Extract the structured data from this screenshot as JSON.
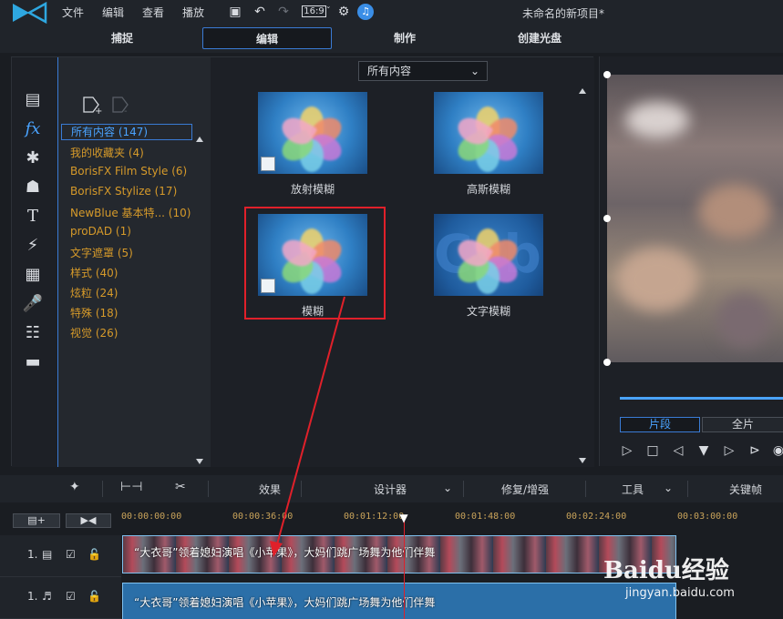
{
  "menu": {
    "file": "文件",
    "edit": "编辑",
    "view": "查看",
    "play": "播放",
    "ratio": "16:9"
  },
  "project_title": "未命名的新项目*",
  "modes": [
    "捕捉",
    "编辑",
    "制作",
    "创建光盘"
  ],
  "library": {
    "filter": "所有内容",
    "search_value": "模糊",
    "categories": [
      "所有内容 (147)",
      "我的收藏夹 (4)",
      "BorisFX Film Style (6)",
      "BorisFX Stylize (17)",
      "NewBlue 基本特... (10)",
      "proDAD (1)",
      "文字遮罩 (5)",
      "样式 (40)",
      "炫粒 (24)",
      "特殊 (18)",
      "视觉 (26)"
    ],
    "effects": [
      "放射模糊",
      "高斯模糊",
      "模糊",
      "文字模糊"
    ],
    "text_thumb_glyphs": "Cvb"
  },
  "preview_tabs": {
    "clip": "片段",
    "full": "全片"
  },
  "toolstrip": {
    "effects": "效果",
    "designer": "设计器",
    "fix": "修复/增强",
    "tools": "工具",
    "keyframe": "关键帧"
  },
  "timeline": {
    "ticks": [
      "00:00:00:00",
      "00:00:36:00",
      "00:01:12:00",
      "00:01:48:00",
      "00:02:24:00",
      "00:03:00:00"
    ],
    "video_track_label": "1.",
    "audio_track_label": "1.",
    "video_clip": "“大衣哥”领着媳妇演唱《小苹果》，大妈们跳广场舞为他们伴舞",
    "audio_clip": "“大衣哥”领着媳妇演唱《小苹果》，大妈们跳广场舞为他们伴舞"
  },
  "watermark": {
    "brand": "Baidu经验",
    "sub": "jingyan.baidu.com"
  },
  "colors": {
    "accent": "#3a7bd5",
    "highlight": "#e0202a",
    "category": "#d69a2a"
  }
}
